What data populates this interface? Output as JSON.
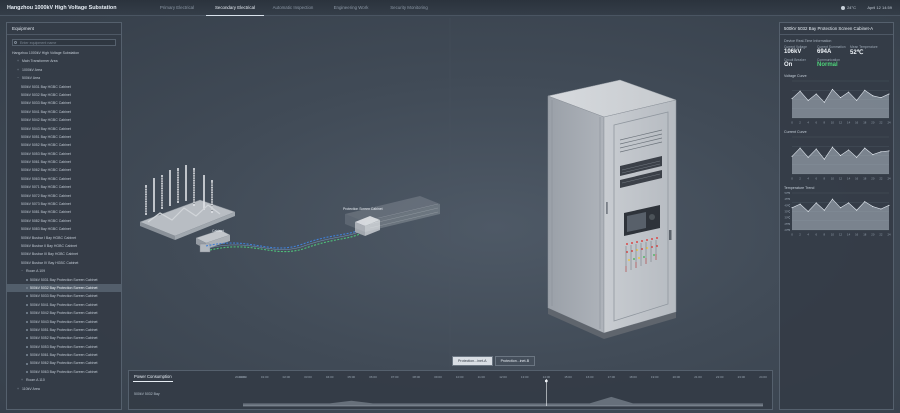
{
  "app": {
    "title": "Hangzhou 1000kV High Voltage Substation",
    "tabs": [
      {
        "label": "Primary Electrical",
        "active": false
      },
      {
        "label": "Secondary Electrical",
        "active": true
      },
      {
        "label": "Automatic Inspection",
        "active": false
      },
      {
        "label": "Engineering Work",
        "active": false
      },
      {
        "label": "Security Monitoring",
        "active": false
      }
    ],
    "weather": "24°C",
    "datetime": "April 12 14:59"
  },
  "equipment": {
    "header": "Equipment",
    "search_placeholder": "Enter equipment name",
    "tree": [
      {
        "label": "Hangzhou 1000kV High Voltage Substation",
        "level": 0,
        "caret": ""
      },
      {
        "label": "Main Transformer Area",
        "level": 1,
        "caret": "+"
      },
      {
        "label": "1000kV Area",
        "level": 1,
        "caret": "+"
      },
      {
        "label": "500kV Area",
        "level": 1,
        "caret": "−"
      },
      {
        "label": "500kV 5031 Bay HGBC Cabinet",
        "level": 2,
        "caret": ""
      },
      {
        "label": "500kV 5032 Bay HGBC Cabinet",
        "level": 2,
        "caret": ""
      },
      {
        "label": "500kV 5033 Bay HGBC Cabinet",
        "level": 2,
        "caret": ""
      },
      {
        "label": "500kV 5041 Bay HGBC Cabinet",
        "level": 2,
        "caret": ""
      },
      {
        "label": "500kV 5042 Bay HGBC Cabinet",
        "level": 2,
        "caret": ""
      },
      {
        "label": "500kV 5043 Bay HGBC Cabinet",
        "level": 2,
        "caret": ""
      },
      {
        "label": "500kV 5051 Bay HGBC Cabinet",
        "level": 2,
        "caret": ""
      },
      {
        "label": "500kV 5052 Bay HGBC Cabinet",
        "level": 2,
        "caret": ""
      },
      {
        "label": "500kV 5053 Bay HGBC Cabinet",
        "level": 2,
        "caret": ""
      },
      {
        "label": "500kV 5061 Bay HGBC Cabinet",
        "level": 2,
        "caret": ""
      },
      {
        "label": "500kV 5062 Bay HGBC Cabinet",
        "level": 2,
        "caret": ""
      },
      {
        "label": "500kV 5063 Bay HGBC Cabinet",
        "level": 2,
        "caret": ""
      },
      {
        "label": "500kV 5071 Bay HGBC Cabinet",
        "level": 2,
        "caret": ""
      },
      {
        "label": "500kV 5072 Bay HGBC Cabinet",
        "level": 2,
        "caret": ""
      },
      {
        "label": "500kV 5073 Bay HGBC Cabinet",
        "level": 2,
        "caret": ""
      },
      {
        "label": "500kV 5081 Bay HGBC Cabinet",
        "level": 2,
        "caret": ""
      },
      {
        "label": "500kV 5082 Bay HGBC Cabinet",
        "level": 2,
        "caret": ""
      },
      {
        "label": "500kV 5083 Bay HGBC Cabinet",
        "level": 2,
        "caret": ""
      },
      {
        "label": "500kV Busbar I Bay HGBC Cabinet",
        "level": 2,
        "caret": ""
      },
      {
        "label": "500kV Busbar II Bay HGBC Cabinet",
        "level": 2,
        "caret": ""
      },
      {
        "label": "500kV Busbar III Bay HGBC Cabinet",
        "level": 2,
        "caret": ""
      },
      {
        "label": "500kV Busbar IV Bay HGBC Cabinet",
        "level": 2,
        "caret": ""
      },
      {
        "label": "Room A 109",
        "level": 2,
        "caret": "−"
      },
      {
        "label": "500kV 5031 Bay Protection Screen Cabinet",
        "level": 3,
        "caret": ""
      },
      {
        "label": "500kV 5032 Bay Protection Screen Cabinet",
        "level": 3,
        "caret": "",
        "selected": true
      },
      {
        "label": "500kV 5033 Bay Protection Screen Cabinet",
        "level": 3,
        "caret": ""
      },
      {
        "label": "500kV 5041 Bay Protection Screen Cabinet",
        "level": 3,
        "caret": ""
      },
      {
        "label": "500kV 5042 Bay Protection Screen Cabinet",
        "level": 3,
        "caret": ""
      },
      {
        "label": "500kV 5043 Bay Protection Screen Cabinet",
        "level": 3,
        "caret": ""
      },
      {
        "label": "500kV 5051 Bay Protection Screen Cabinet",
        "level": 3,
        "caret": ""
      },
      {
        "label": "500kV 5052 Bay Protection Screen Cabinet",
        "level": 3,
        "caret": ""
      },
      {
        "label": "500kV 5053 Bay Protection Screen Cabinet",
        "level": 3,
        "caret": ""
      },
      {
        "label": "500kV 5061 Bay Protection Screen Cabinet",
        "level": 3,
        "caret": ""
      },
      {
        "label": "500kV 5062 Bay Protection Screen Cabinet",
        "level": 3,
        "caret": ""
      },
      {
        "label": "500kV 5063 Bay Protection Screen Cabinet",
        "level": 3,
        "caret": ""
      },
      {
        "label": "Room A 110",
        "level": 2,
        "caret": "+"
      },
      {
        "label": "110kV Area",
        "level": 1,
        "caret": "+"
      }
    ]
  },
  "scene": {
    "label_cabinet_hub": "Protection Screen Cabinet",
    "label_cabinet_small": "Cabinet",
    "view_tabs": [
      {
        "label": "Protection...inet-A",
        "active": true
      },
      {
        "label": "Protection...inet-B",
        "active": false
      }
    ]
  },
  "detail": {
    "title": "500kV 5032 Bay Protection Screen Cabinet-A",
    "section": "Device Real-Time Information",
    "metrics": [
      {
        "label": "Current Voltage",
        "value": "106kV",
        "status": "normal"
      },
      {
        "label": "Current Summation",
        "value": "694A",
        "status": "normal"
      },
      {
        "label": "Mean Temperature",
        "value": "52℃",
        "status": "normal"
      },
      {
        "label": "Circuit Breaker",
        "value": "On",
        "status": "normal"
      },
      {
        "label": "Communication",
        "value": "Normal",
        "status": "ok"
      }
    ],
    "charts": [
      {
        "title": "Voltage Curve",
        "color": "#c3ccd6"
      },
      {
        "title": "Current Curve",
        "color": "#c3ccd6"
      },
      {
        "title": "Temperature Trend",
        "color": "#c3ccd6"
      }
    ]
  },
  "chart_data": [
    {
      "type": "area",
      "title": "Voltage Curve",
      "x": [
        "0",
        "2",
        "4",
        "6",
        "8",
        "10",
        "12",
        "14",
        "16",
        "18",
        "20",
        "22",
        "24"
      ],
      "values": [
        2.1,
        2.9,
        1.9,
        2.6,
        1.7,
        3.1,
        2.2,
        2.8,
        1.9,
        3.0,
        2.4,
        2.2,
        2.6
      ],
      "ylim": [
        0,
        4
      ]
    },
    {
      "type": "area",
      "title": "Current Curve",
      "x": [
        "0",
        "2",
        "4",
        "6",
        "8",
        "10",
        "12",
        "14",
        "16",
        "18",
        "20",
        "22",
        "24"
      ],
      "values": [
        1.9,
        2.8,
        1.8,
        2.7,
        1.6,
        2.9,
        2.0,
        2.6,
        1.8,
        2.8,
        2.1,
        2.4,
        2.5
      ],
      "ylim": [
        0,
        4
      ]
    },
    {
      "type": "area",
      "title": "Temperature Trend",
      "x": [
        "0",
        "2",
        "4",
        "6",
        "8",
        "10",
        "12",
        "14",
        "16",
        "18",
        "20",
        "22",
        "24"
      ],
      "values": [
        38,
        41,
        35,
        42,
        36,
        45,
        38,
        42,
        36,
        43,
        39,
        37,
        40
      ],
      "yticks": [
        "20℃",
        "25℃",
        "30℃",
        "35℃",
        "40℃",
        "45℃",
        "50℃"
      ],
      "ylim": [
        20,
        50
      ]
    },
    {
      "type": "area",
      "title": "Power Consumption",
      "series_label": "500kV 5032 Bay",
      "x": [
        "00:00",
        "01:00",
        "02:00",
        "03:00",
        "04:00",
        "05:00",
        "06:00",
        "07:00",
        "08:00",
        "09:00",
        "10:00",
        "11:00",
        "12:00",
        "13:00",
        "14:00",
        "15:00",
        "16:00",
        "17:00",
        "18:00",
        "19:00",
        "20:00",
        "21:00",
        "22:00",
        "23:00",
        "24:00"
      ],
      "left_label": "2024.01",
      "values": [
        0.1,
        0.1,
        0.1,
        0.1,
        0.1,
        0.2,
        0.1,
        0.1,
        0.1,
        0.1,
        0.1,
        0.1,
        0.1,
        0.1,
        0.1,
        0.1,
        0.1,
        0.35,
        0.1,
        0.1,
        0.1,
        0.1,
        0.1,
        0.1,
        0.1
      ],
      "marker_x": "14:00"
    }
  ]
}
